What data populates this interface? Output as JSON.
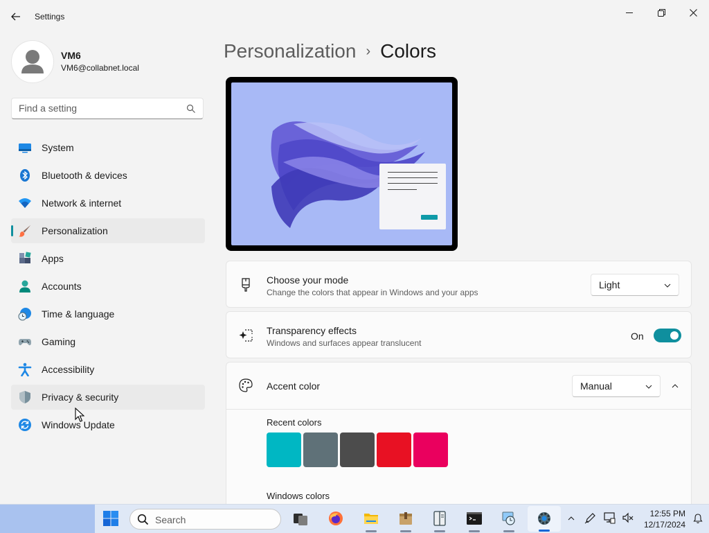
{
  "app": {
    "title": "Settings"
  },
  "profile": {
    "name": "VM6",
    "email": "VM6@collabnet.local"
  },
  "search": {
    "placeholder": "Find a setting"
  },
  "nav": {
    "items": [
      {
        "label": "System",
        "icon": "monitor-icon"
      },
      {
        "label": "Bluetooth & devices",
        "icon": "bluetooth-icon"
      },
      {
        "label": "Network & internet",
        "icon": "wifi-icon"
      },
      {
        "label": "Personalization",
        "icon": "paintbrush-icon",
        "selected": true
      },
      {
        "label": "Apps",
        "icon": "apps-icon"
      },
      {
        "label": "Accounts",
        "icon": "person-icon"
      },
      {
        "label": "Time & language",
        "icon": "globe-clock-icon"
      },
      {
        "label": "Gaming",
        "icon": "gamepad-icon"
      },
      {
        "label": "Accessibility",
        "icon": "accessibility-icon"
      },
      {
        "label": "Privacy & security",
        "icon": "shield-icon",
        "hovered": true
      },
      {
        "label": "Windows Update",
        "icon": "sync-icon"
      }
    ]
  },
  "page": {
    "parent": "Personalization",
    "separator": "›",
    "current": "Colors"
  },
  "mode": {
    "title": "Choose your mode",
    "subtitle": "Change the colors that appear in Windows and your apps",
    "value": "Light"
  },
  "transparency": {
    "title": "Transparency effects",
    "subtitle": "Windows and surfaces appear translucent",
    "state_label": "On",
    "enabled": true
  },
  "accent": {
    "title": "Accent color",
    "value": "Manual",
    "expanded": true
  },
  "recent_colors": {
    "label": "Recent colors",
    "swatches": [
      "#00b7c3",
      "#5f7178",
      "#4c4c4c",
      "#e81123",
      "#ea005e"
    ]
  },
  "windows_colors": {
    "label": "Windows colors"
  },
  "taskbar": {
    "search_label": "Search",
    "time": "12:55 PM",
    "date": "12/17/2024"
  },
  "colors": {
    "accent": "#0f8f9e",
    "background": "#f3f3f3",
    "card": "#fbfbfb"
  }
}
